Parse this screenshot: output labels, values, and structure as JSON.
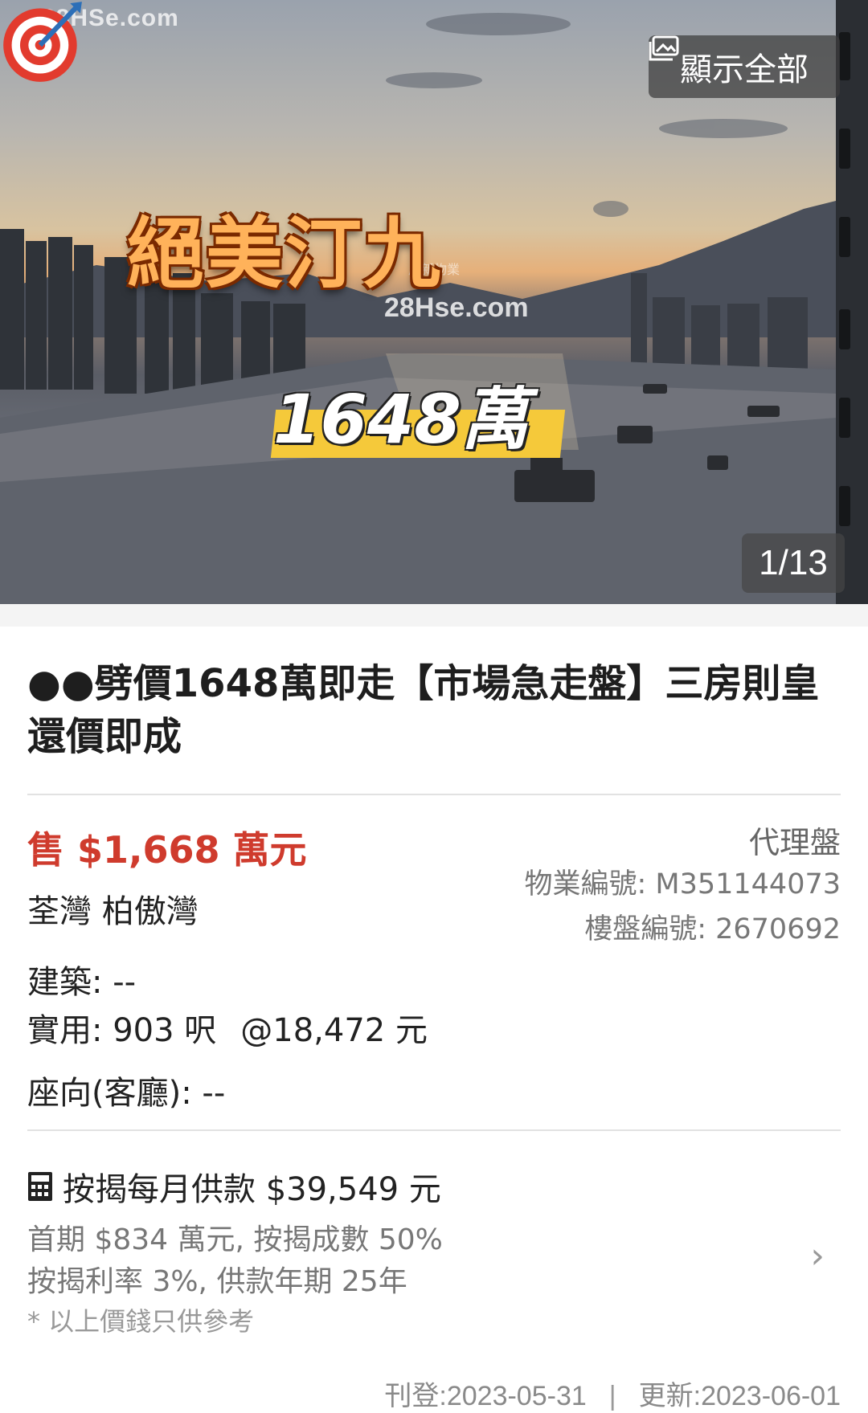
{
  "hero": {
    "watermark": "28HSe.com",
    "watermark_mid": "28Hse.com",
    "watermark_small": "屋新物業",
    "promo_title": "絕美汀九",
    "promo_price": "1648萬",
    "show_all_label": "顯示全部",
    "photo_counter": "1/13"
  },
  "listing": {
    "title": "●●劈價1648萬即走【市場急走盤】三房則皇 還價即成",
    "price": "售 $1,668 萬元",
    "location": "荃灣 柏傲灣",
    "agent_type": "代理盤",
    "property_id": "物業編號: M351144073",
    "listing_id": "樓盤編號: 2670692",
    "gross_area": "建築: --",
    "saleable_area": "實用: 903 呎",
    "unit_price": "@18,472 元",
    "facing": "座向(客廳): --"
  },
  "mortgage": {
    "monthly": "按揭每月供款 $39,549 元",
    "line1": "首期 $834 萬元, 按揭成數 50%",
    "line2": "按揭利率 3%, 供款年期 25年",
    "note": "* 以上價錢只供參考"
  },
  "footer": {
    "posted": "刊登:2023-05-31",
    "separator": "|",
    "updated": "更新:2023-06-01"
  }
}
